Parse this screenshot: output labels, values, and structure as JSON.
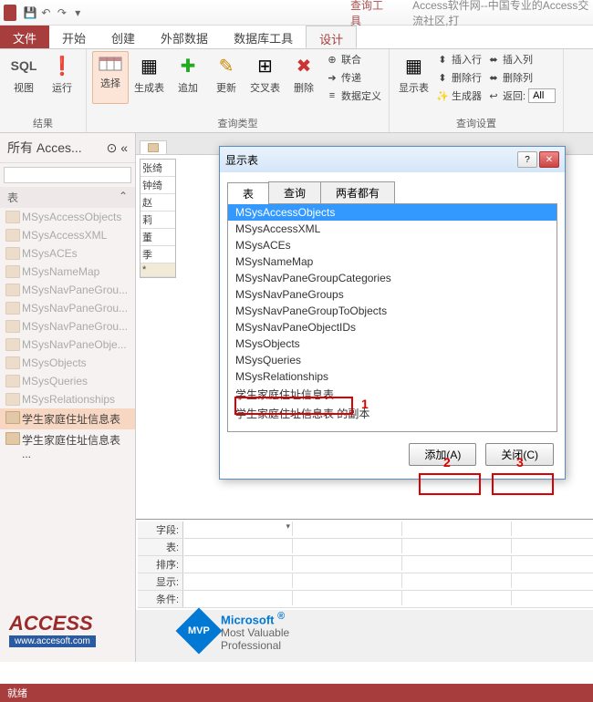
{
  "window": {
    "context_tab": "查询工具",
    "title": "Access软件网--中国专业的Access交流社区,打"
  },
  "qat": [
    "save",
    "undo",
    "redo"
  ],
  "tabs": {
    "file": "文件",
    "items": [
      "开始",
      "创建",
      "外部数据",
      "数据库工具",
      "设计"
    ],
    "active": "设计"
  },
  "ribbon": {
    "g1": {
      "sql": "SQL",
      "view": "视图",
      "run": "运行",
      "label": "结果"
    },
    "g2": {
      "select": "选择",
      "mktable": "生成表",
      "append": "追加",
      "update": "更新",
      "cross": "交叉表",
      "delete": "删除",
      "r1": "联合",
      "r2": "传递",
      "r3": "数据定义",
      "label": "查询类型"
    },
    "g3": {
      "show": "显示表",
      "label": ""
    },
    "g4": {
      "r1": "插入行",
      "r2": "删除行",
      "r3": "生成器"
    },
    "g5": {
      "r1": "插入列",
      "r2": "删除列",
      "ret": "返回:",
      "retval": "All",
      "label": "查询设置"
    }
  },
  "nav": {
    "header": "所有 Acces...",
    "section": "表",
    "items": [
      {
        "t": "MSysAccessObjects",
        "en": false
      },
      {
        "t": "MSysAccessXML",
        "en": false
      },
      {
        "t": "MSysACEs",
        "en": false
      },
      {
        "t": "MSysNameMap",
        "en": false
      },
      {
        "t": "MSysNavPaneGrou...",
        "en": false
      },
      {
        "t": "MSysNavPaneGrou...",
        "en": false
      },
      {
        "t": "MSysNavPaneGrou...",
        "en": false
      },
      {
        "t": "MSysNavPaneObje...",
        "en": false
      },
      {
        "t": "MSysObjects",
        "en": false
      },
      {
        "t": "MSysQueries",
        "en": false
      },
      {
        "t": "MSysRelationships",
        "en": false
      },
      {
        "t": "学生家庭住址信息表",
        "en": true,
        "sel": true
      },
      {
        "t": "学生家庭住址信息表 ...",
        "en": true
      }
    ]
  },
  "doc_tab": "",
  "table_rows": [
    "张绮",
    "钟绮",
    "赵",
    "莉",
    "董",
    "季",
    "*"
  ],
  "grid_labels": [
    "字段:",
    "表:",
    "排序:",
    "显示:",
    "条件:"
  ],
  "dialog": {
    "title": "显示表",
    "tabs": [
      "表",
      "查询",
      "两者都有"
    ],
    "active_tab": "表",
    "items": [
      "MSysAccessObjects",
      "MSysAccessXML",
      "MSysACEs",
      "MSysNameMap",
      "MSysNavPaneGroupCategories",
      "MSysNavPaneGroups",
      "MSysNavPaneGroupToObjects",
      "MSysNavPaneObjectIDs",
      "MSysObjects",
      "MSysQueries",
      "MSysRelationships",
      "学生家庭住址信息表",
      "学生家庭住址信息表 的副本"
    ],
    "selected": "MSysAccessObjects",
    "add_btn": "添加(A)",
    "close_btn": "关闭(C)"
  },
  "annotations": {
    "n1": "1",
    "n2": "2",
    "n3": "3"
  },
  "status": "就绪",
  "watermark": {
    "access": "ACCESS",
    "url": "www.accesoft.com",
    "m1": "Microsoft",
    "m2": "Most Valuable",
    "m3": "Professional",
    "mvp": "MVP"
  }
}
